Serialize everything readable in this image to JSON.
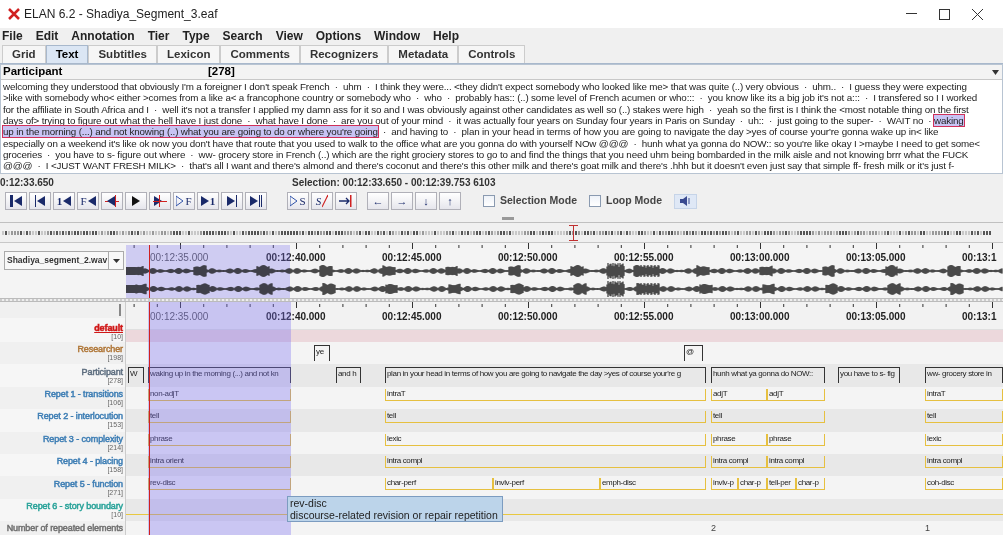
{
  "window": {
    "title": "ELAN 6.2 - Shadiya_Segment_3.eaf"
  },
  "menu": [
    "File",
    "Edit",
    "Annotation",
    "Tier",
    "Type",
    "Search",
    "View",
    "Options",
    "Window",
    "Help"
  ],
  "tabs": [
    {
      "label": "Grid",
      "selected": false
    },
    {
      "label": "Text",
      "selected": true
    },
    {
      "label": "Subtitles",
      "selected": false
    },
    {
      "label": "Lexicon",
      "selected": false
    },
    {
      "label": "Comments",
      "selected": false
    },
    {
      "label": "Recognizers",
      "selected": false
    },
    {
      "label": "Metadata",
      "selected": false
    },
    {
      "label": "Controls",
      "selected": false
    }
  ],
  "text_view": {
    "tier": "Participant",
    "count": "[278]",
    "lines": [
      [
        {
          "text": "welcoming they understood that obviously I'm a foreigner I don't speak French  ·  uhm  ·  I think they were... <they didn't expect somebody who looked like me> that was quite (..) very obvious  ·  uhm..  ·  I guess they were expecting",
          "highlighted": false
        }
      ],
      [
        {
          "text": ">like with somebody who< either >comes from a like a< a francophone country or somebody who  ·  who  ·  probably has:: (..) some level of French acumen or who:::  ·  you know like its a big job it's not a:::  ·  I transfered so I I worked",
          "highlighted": false
        }
      ],
      [
        {
          "text": "for the affiliate in South Africa and I  ·  well it's not a transfer I applied my damn ass for it so and I was obviously against other candidates as well so (..) stakes were high  ·  yeah so the first is I think the <most notable thing on the first",
          "highlighted": false
        }
      ],
      [
        {
          "text": "days of> trying to figure out what the hell have I just done  ·  what have I done  ·  are you out of your mind  ·  it was actually four years on Sunday four years in Paris on Sunday  ·  uh::  ·  just going to the super-  ·  WAIT no  · ",
          "highlighted": false
        },
        {
          "text": "waking",
          "highlighted": true
        }
      ],
      [
        {
          "text": "up in the morning (...) and not knowing (..) what you are going to do or where you're going",
          "highlighted": true
        },
        {
          "text": "  ·  and having to  ·  plan in your head in terms of how you are going to navigate the day >yes of course your're gonna wake up in< like",
          "highlighted": false
        }
      ],
      [
        {
          "text": "especially on a weekend it's like ok now you don't have that route that you used to walk to the office what are you gonna do with yourself NOw @@@  ·  hunh what ya gonna do NOW:: so you're like okay I >maybe I need to get some<",
          "highlighted": false
        }
      ],
      [
        {
          "text": "groceries  ·  you have to s- figure out where  ·  ww- grocery store in French (..) which are the right grociery stores to go to and find the things that you need uhm being bombarded in the milk aisle and not knowing brrr what the FUCK",
          "highlighted": false
        }
      ],
      [
        {
          "text": "@@@  ·  I <JUST WANT FRESH MILK>  ·  that's all I want and there's almond and there's coconut and there's this other milk and there's goat milk and there's .hhh but it doesn't even just say that simple ff- fresh milk or it's just f-",
          "highlighted": false
        }
      ]
    ]
  },
  "media": {
    "time": "0:12:33.650",
    "selection": "Selection: 00:12:33.650 - 00:12:39.753 6103",
    "transport": [
      {
        "kind": "go-begin"
      },
      {
        "kind": "prev-pixel"
      },
      {
        "kind": "prev-second",
        "letter": "1"
      },
      {
        "kind": "prev-frame",
        "letter": "F"
      },
      {
        "kind": "prev-boundary"
      },
      {
        "kind": "play"
      },
      {
        "kind": "next-boundary"
      },
      {
        "kind": "next-frame",
        "letter": "F"
      },
      {
        "kind": "next-second",
        "letter": "1"
      },
      {
        "kind": "next-pixel"
      },
      {
        "kind": "go-end"
      }
    ],
    "selection_buttons": [
      {
        "kind": "play-selection",
        "letter": "S"
      },
      {
        "kind": "clear-selection",
        "letter": "S"
      },
      {
        "kind": "to-boundary"
      }
    ],
    "arrows": [
      "←",
      "→",
      "↓",
      "↑"
    ],
    "modes": [
      {
        "label": "Selection Mode",
        "checked": false
      },
      {
        "label": "Loop Mode",
        "checked": false
      }
    ]
  },
  "waveform": {
    "file": "Shadiya_segment_2.wav",
    "ruler": [
      "00:12:35.000",
      "00:12:40.000",
      "00:12:45.000",
      "00:12:50.000",
      "00:12:55.000",
      "00:13:00.000",
      "00:13:05.000",
      "00:13:1"
    ]
  },
  "timeline_ruler": [
    "00:12:35.000",
    "00:12:40.000",
    "00:12:45.000",
    "00:12:50.000",
    "00:12:55.000",
    "00:13:00.000",
    "00:13:05.000",
    "00:13:1"
  ],
  "tiers": [
    {
      "name": "default",
      "count": "[10]",
      "color": "#d01818",
      "selected": true
    },
    {
      "name": "Researcher",
      "count": "[198]",
      "color": "#b0783a",
      "selected": false,
      "annotations": [
        "ye",
        "@"
      ]
    },
    {
      "name": "Participant",
      "count": "[278]",
      "color": "#5f6f80",
      "selected": false,
      "annotations": [
        "W",
        "waking up in the morning (...) and not kn",
        "and h",
        "plan in your head in terms of how you are going to navigate the day >yes of course your're g",
        "hunh what ya gonna do NOW::",
        "you have to s- fig",
        "ww- grocery store in"
      ]
    },
    {
      "name": "Repet 1 - transitions",
      "count": "[106]",
      "color": "#3f7fb5",
      "selected": false,
      "annotations": [
        "non-adjT",
        "intraT",
        "adjT",
        "adjT",
        "intraT"
      ]
    },
    {
      "name": "Repet 2 - interlocution",
      "count": "[153]",
      "color": "#3f7fb5",
      "selected": false,
      "annotations": [
        "tell",
        "tell",
        "tell",
        "tell"
      ]
    },
    {
      "name": "Repet 3 - complexity",
      "count": "[214]",
      "color": "#3f7fb5",
      "selected": false,
      "annotations": [
        "phrase",
        "lexic",
        "phrase",
        "phrase",
        "lexic"
      ]
    },
    {
      "name": "Repet 4 - placing",
      "count": "[158]",
      "color": "#3f7fb5",
      "selected": false,
      "annotations": [
        "intra orient",
        "intra compl",
        "intra compl",
        "intra compl",
        "intra compl"
      ]
    },
    {
      "name": "Repet 5 - function",
      "count": "[271]",
      "color": "#3f7fb5",
      "selected": false,
      "annotations": [
        "rev-disc",
        "char-perf",
        "invlv-perf",
        "emph-disc",
        "invlv-p",
        "char-p",
        "tell-per",
        "char-p",
        "coh-disc"
      ]
    },
    {
      "name": "Repet 6 - story boundary",
      "count": "[10]",
      "color": "#2aa39a",
      "selected": false
    },
    {
      "name": "Number of repeated elements",
      "color": "#707070",
      "selected": false,
      "annotations": [
        "2",
        "1"
      ]
    }
  ],
  "tooltip": {
    "title": "rev-disc",
    "text": "discourse-related revision or repair repetition"
  }
}
